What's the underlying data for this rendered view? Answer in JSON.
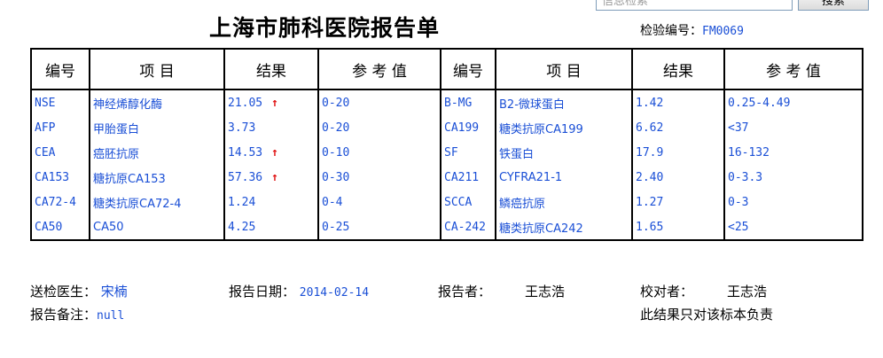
{
  "search": {
    "placeholder": "信息检索",
    "button_label": "搜索"
  },
  "header": {
    "title": "上海市肺科医院报告单",
    "serial_label": "检验编号：",
    "serial_value": "FM0069"
  },
  "table": {
    "headers": [
      "编号",
      "项 目",
      "结果",
      "参 考 值",
      "编号",
      "项 目",
      "结果",
      "参 考 值"
    ],
    "rows": [
      {
        "code1": "NSE",
        "item1": "神经烯醇化酶",
        "result1": "21.05",
        "high1": true,
        "ref1": "0-20",
        "code2": "B-MG",
        "item2": "B2-微球蛋白",
        "result2": "1.42",
        "ref2": "0.25-4.49"
      },
      {
        "code1": "AFP",
        "item1": "甲胎蛋白",
        "result1": "3.73",
        "high1": false,
        "ref1": "0-20",
        "code2": "CA199",
        "item2": "糖类抗原CA199",
        "result2": "6.62",
        "ref2": "<37"
      },
      {
        "code1": "CEA",
        "item1": "癌胚抗原",
        "result1": "14.53",
        "high1": true,
        "ref1": "0-10",
        "code2": "SF",
        "item2": "铁蛋白",
        "result2": "17.9",
        "ref2": "16-132"
      },
      {
        "code1": "CA153",
        "item1": "糖抗原CA153",
        "result1": "57.36",
        "high1": true,
        "ref1": "0-30",
        "code2": "CA211",
        "item2": "CYFRA21-1",
        "result2": "2.40",
        "ref2": "0-3.3"
      },
      {
        "code1": "CA72-4",
        "item1": "糖类抗原CA72-4",
        "result1": "1.24",
        "high1": false,
        "ref1": "0-4",
        "code2": "SCCA",
        "item2": "鳞癌抗原",
        "result2": "1.27",
        "ref2": "0-3"
      },
      {
        "code1": "CA50",
        "item1": "CA50",
        "result1": "4.25",
        "high1": false,
        "ref1": "0-25",
        "code2": "CA-242",
        "item2": "糖类抗原CA242",
        "result2": "1.65",
        "ref2": "<25"
      }
    ],
    "high_marker": "↑"
  },
  "footer": {
    "doctor_label": "送检医生：",
    "doctor_value": "宋楠",
    "date_label": "报告日期：",
    "date_value": "2014-02-14",
    "reporter_label": "报告者：",
    "reporter_value": "王志浩",
    "checker_label": "校对者：",
    "checker_value": "王志浩",
    "remark_label": "报告备注：",
    "remark_value": "null",
    "disclaimer": "此结果只对该标本负责"
  },
  "colors": {
    "value_blue": "#1a4fd6",
    "high_red": "#e01010"
  }
}
